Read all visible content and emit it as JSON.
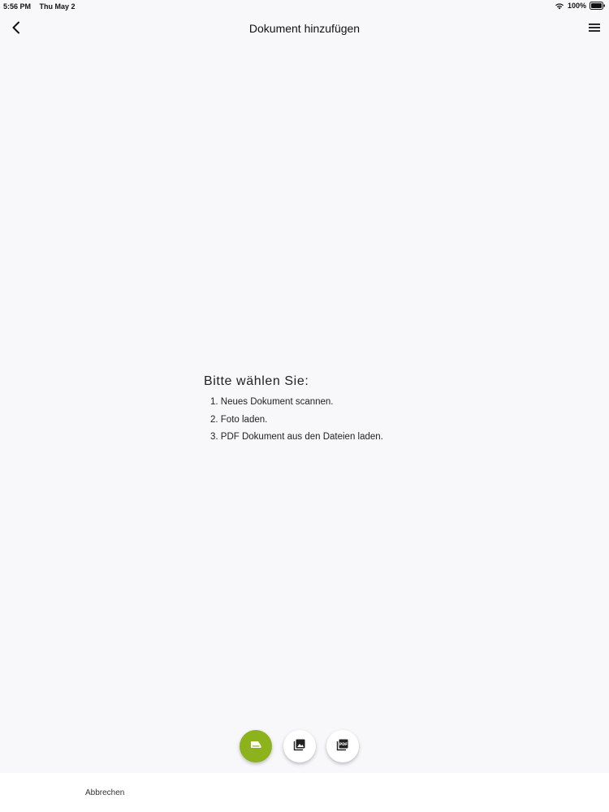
{
  "status_bar": {
    "time": "5:56 PM",
    "date": "Thu May 2",
    "battery": "100%",
    "icons": [
      "wifi-icon",
      "battery-icon"
    ]
  },
  "nav": {
    "title": "Dokument hinzufügen",
    "back_icon": "chevron-left-icon",
    "menu_icon": "hamburger-menu-icon"
  },
  "instructions": {
    "title": "Bitte wählen Sie:",
    "items": [
      "1. Neues Dokument scannen.",
      "2. Foto laden.",
      "3. PDF Dokument aus den Dateien laden."
    ]
  },
  "actions": {
    "scan_icon": "scanner-icon",
    "photo_icon": "photo-icon",
    "pdf_icon": "pdf-icon",
    "pdf_icon_text": "PDF",
    "accent_color": "#8cb21c"
  },
  "footer": {
    "cancel_label": "Abbrechen"
  }
}
